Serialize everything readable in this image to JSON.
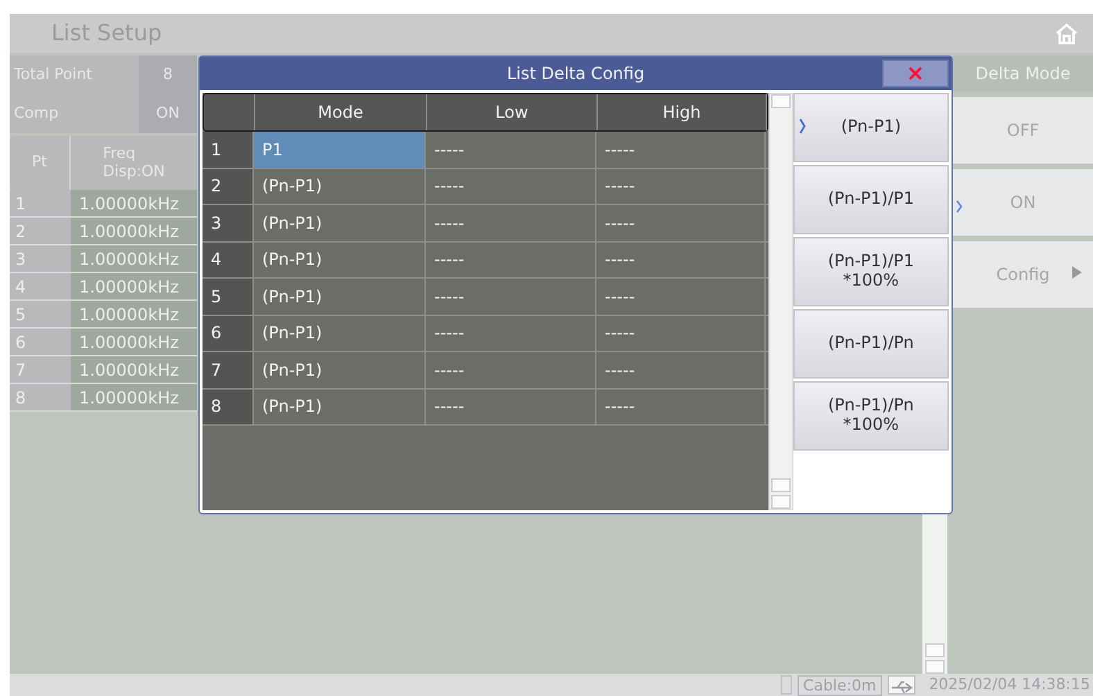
{
  "title": "List Setup",
  "settings": [
    {
      "label": "Total Point",
      "value": "8"
    },
    {
      "label": "Comp",
      "value": "ON"
    }
  ],
  "list_table": {
    "columns": [
      {
        "lines": [
          "Pt"
        ]
      },
      {
        "lines": [
          "Freq",
          "Disp:ON"
        ]
      }
    ],
    "rows": [
      {
        "pt": "1",
        "freq": "1.00000kHz"
      },
      {
        "pt": "2",
        "freq": "1.00000kHz"
      },
      {
        "pt": "3",
        "freq": "1.00000kHz"
      },
      {
        "pt": "4",
        "freq": "1.00000kHz"
      },
      {
        "pt": "5",
        "freq": "1.00000kHz"
      },
      {
        "pt": "6",
        "freq": "1.00000kHz"
      },
      {
        "pt": "7",
        "freq": "1.00000kHz"
      },
      {
        "pt": "8",
        "freq": "1.00000kHz"
      }
    ]
  },
  "dialog": {
    "title": "List Delta Config",
    "close": "×",
    "columns": [
      "Mode",
      "Low",
      "High"
    ],
    "rows": [
      {
        "index": "1",
        "mode": "P1",
        "low": "-----",
        "high": "-----",
        "selected": true
      },
      {
        "index": "2",
        "mode": "(Pn-P1)",
        "low": "-----",
        "high": "-----",
        "selected": false
      },
      {
        "index": "3",
        "mode": "(Pn-P1)",
        "low": "-----",
        "high": "-----",
        "selected": false
      },
      {
        "index": "4",
        "mode": "(Pn-P1)",
        "low": "-----",
        "high": "-----",
        "selected": false
      },
      {
        "index": "5",
        "mode": "(Pn-P1)",
        "low": "-----",
        "high": "-----",
        "selected": false
      },
      {
        "index": "6",
        "mode": "(Pn-P1)",
        "low": "-----",
        "high": "-----",
        "selected": false
      },
      {
        "index": "7",
        "mode": "(Pn-P1)",
        "low": "-----",
        "high": "-----",
        "selected": false
      },
      {
        "index": "8",
        "mode": "(Pn-P1)",
        "low": "-----",
        "high": "-----",
        "selected": false
      }
    ],
    "options": [
      {
        "lines": [
          "(Pn-P1)"
        ],
        "selected": true
      },
      {
        "lines": [
          "(Pn-P1)/P1"
        ],
        "selected": false
      },
      {
        "lines": [
          "(Pn-P1)/P1",
          "*100%"
        ],
        "selected": false
      },
      {
        "lines": [
          "(Pn-P1)/Pn"
        ],
        "selected": false
      },
      {
        "lines": [
          "(Pn-P1)/Pn",
          "*100%"
        ],
        "selected": false
      }
    ]
  },
  "softkeys": {
    "title": "Delta Mode",
    "items": [
      {
        "label": "OFF",
        "kind": "option",
        "selected": false
      },
      {
        "label": "ON",
        "kind": "option",
        "selected": true
      },
      {
        "label": "Config",
        "kind": "submenu",
        "selected": false
      }
    ]
  },
  "status_bar": {
    "cable": "Cable:0m",
    "datetime": "2025/02/04 14:38:15"
  }
}
